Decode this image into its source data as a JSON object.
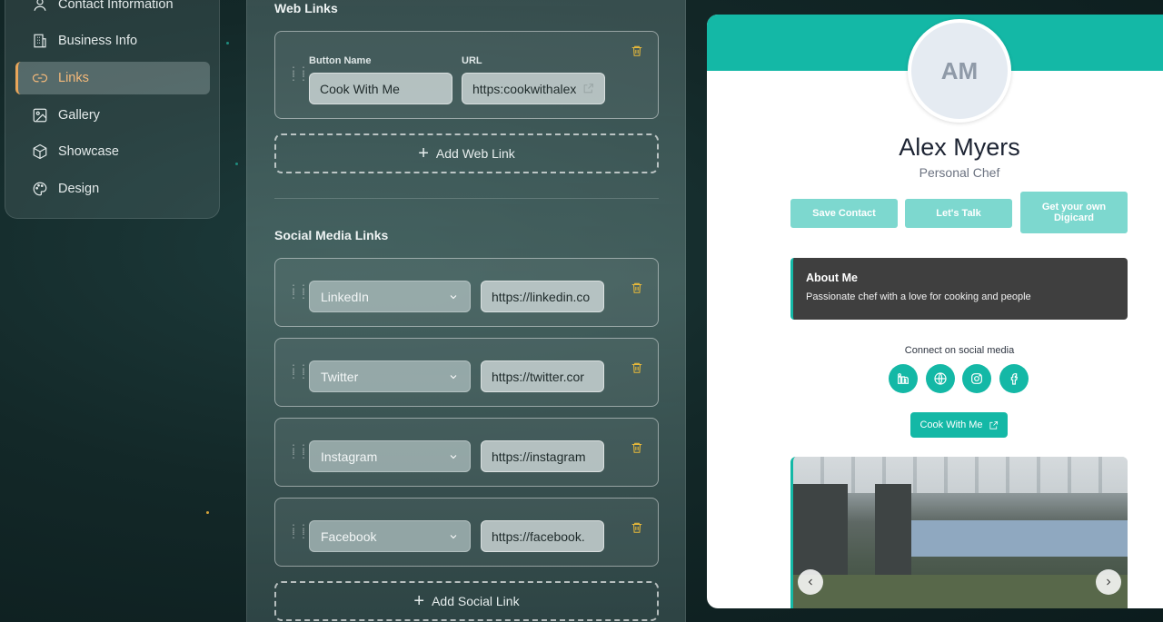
{
  "sidebar": {
    "items": [
      {
        "label": "Contact Information",
        "icon": "user-icon"
      },
      {
        "label": "Business Info",
        "icon": "building-icon"
      },
      {
        "label": "Links",
        "icon": "link-icon",
        "active": true
      },
      {
        "label": "Gallery",
        "icon": "image-icon"
      },
      {
        "label": "Showcase",
        "icon": "box-icon"
      },
      {
        "label": "Design",
        "icon": "palette-icon"
      }
    ]
  },
  "editor": {
    "web_links_title": "Web Links",
    "button_name_label": "Button Name",
    "url_label": "URL",
    "web_link": {
      "name": "Cook With Me",
      "url": "https:cookwithalex"
    },
    "add_web_link": "Add Web Link",
    "social_title": "Social Media Links",
    "social_links": [
      {
        "platform": "LinkedIn",
        "url": "https://linkedin.co"
      },
      {
        "platform": "Twitter",
        "url": "https://twitter.cor"
      },
      {
        "platform": "Instagram",
        "url": "https://instagram"
      },
      {
        "platform": "Facebook",
        "url": "https://facebook."
      }
    ],
    "add_social_link": "Add Social Link"
  },
  "preview": {
    "initials": "AM",
    "name": "Alex Myers",
    "role": "Personal Chef",
    "buttons": [
      "Save Contact",
      "Let's Talk",
      "Get your own Digicard"
    ],
    "about_title": "About Me",
    "about_text": "Passionate chef with a love for cooking and people",
    "social_caption": "Connect on social media",
    "link_button": "Cook With Me"
  },
  "colors": {
    "accent": "#14b8a6",
    "active_nav": "#e9a65a",
    "trash": "#e8b93a"
  }
}
